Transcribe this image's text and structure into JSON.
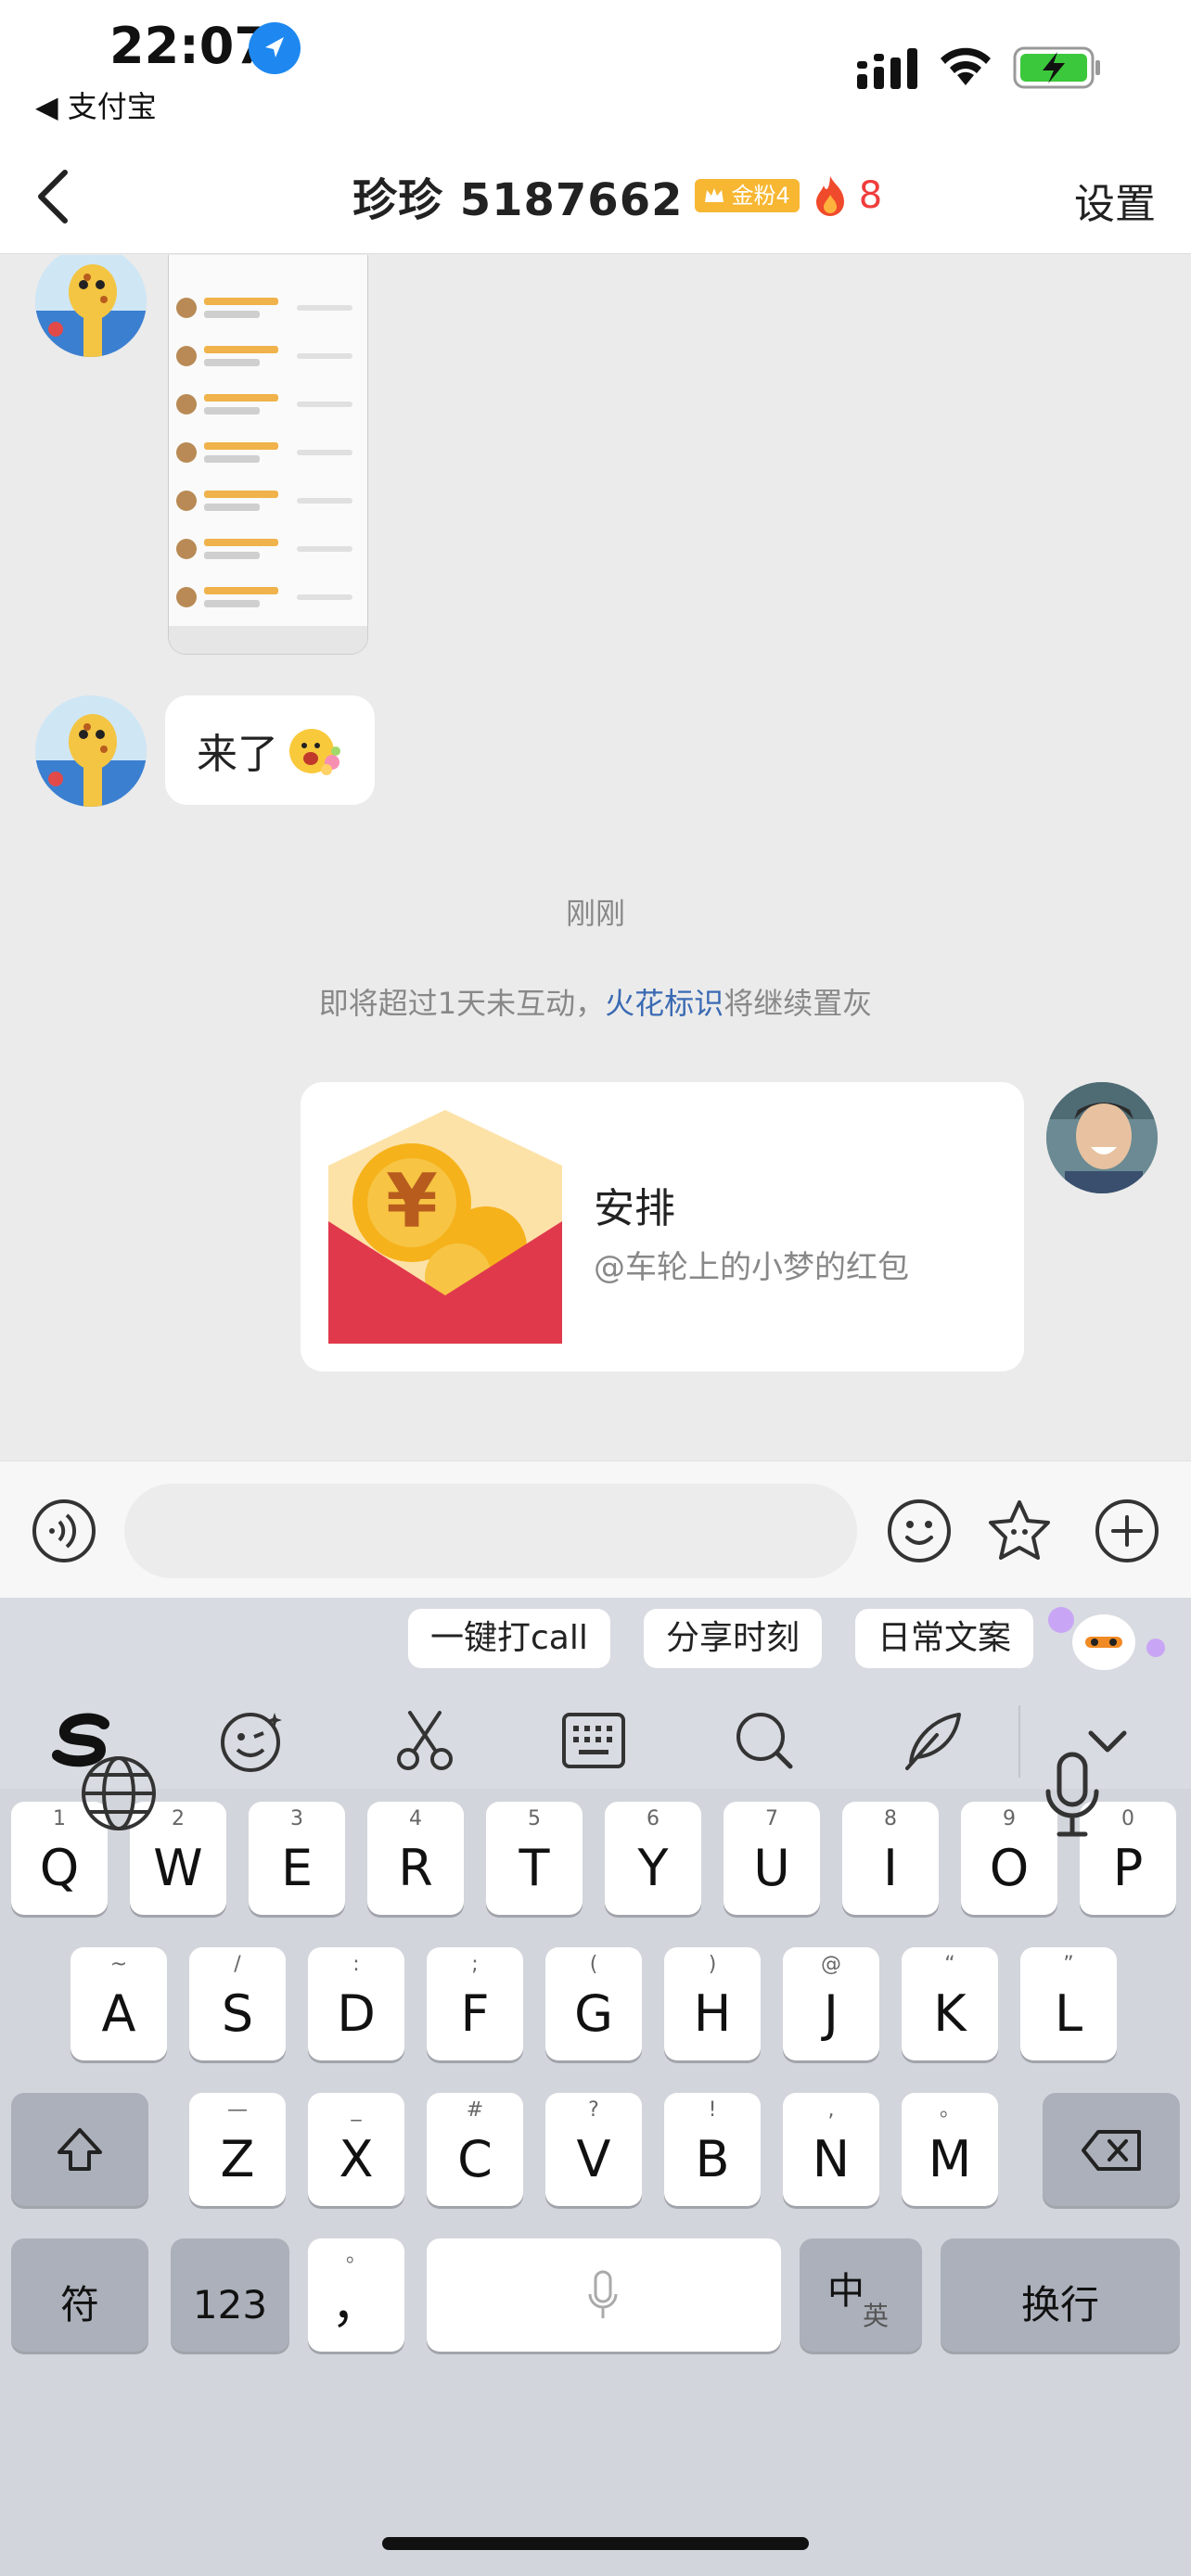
{
  "status_bar": {
    "time": "22:07",
    "back_app": "◀ 支付宝",
    "icons": [
      "location-arrow-icon",
      "cellular-signal-icon",
      "wifi-icon",
      "battery-charging-icon"
    ]
  },
  "nav": {
    "title": "珍珍 5187662",
    "fan_badge": "金粉4",
    "fire_count": "8",
    "settings": "设置"
  },
  "chat": {
    "messages": [
      {
        "side": "left",
        "type": "image"
      },
      {
        "side": "left",
        "type": "text",
        "text": "来了"
      }
    ],
    "time_label": "刚刚",
    "system_tip": {
      "before": "即将超过1天未互动，",
      "link": "火花标识",
      "after": "将继续置灰"
    },
    "red_packet": {
      "title": "安排",
      "subtitle": "@车轮上的小梦的红包"
    }
  },
  "input_bar": {
    "placeholder": ""
  },
  "keyboard": {
    "chips": [
      "一键打call",
      "分享时刻",
      "日常文案"
    ],
    "tools": [
      "sogou-logo-icon",
      "emoji-icon",
      "scissors-icon",
      "keyboard-icon",
      "search-icon",
      "pen-icon",
      "chevron-down-icon"
    ],
    "row1": [
      {
        "main": "Q",
        "sub": "1"
      },
      {
        "main": "W",
        "sub": "2"
      },
      {
        "main": "E",
        "sub": "3"
      },
      {
        "main": "R",
        "sub": "4"
      },
      {
        "main": "T",
        "sub": "5"
      },
      {
        "main": "Y",
        "sub": "6"
      },
      {
        "main": "U",
        "sub": "7"
      },
      {
        "main": "I",
        "sub": "8"
      },
      {
        "main": "O",
        "sub": "9"
      },
      {
        "main": "P",
        "sub": "0"
      }
    ],
    "row2": [
      {
        "main": "A",
        "sub": "~"
      },
      {
        "main": "S",
        "sub": "/"
      },
      {
        "main": "D",
        "sub": ":"
      },
      {
        "main": "F",
        "sub": ";"
      },
      {
        "main": "G",
        "sub": "("
      },
      {
        "main": "H",
        "sub": ")"
      },
      {
        "main": "J",
        "sub": "@"
      },
      {
        "main": "K",
        "sub": "“"
      },
      {
        "main": "L",
        "sub": "”"
      }
    ],
    "row3": [
      {
        "main": "Z",
        "sub": "—"
      },
      {
        "main": "X",
        "sub": "_"
      },
      {
        "main": "C",
        "sub": "#"
      },
      {
        "main": "V",
        "sub": "?"
      },
      {
        "main": "B",
        "sub": "!"
      },
      {
        "main": "N",
        "sub": ","
      },
      {
        "main": "M",
        "sub": "。"
      }
    ],
    "symbol_key": "符",
    "number_key": "123",
    "punct_key": "，",
    "punct_sub": "。",
    "lang_key_main": "中",
    "lang_key_sub": "英",
    "return_key": "换行"
  }
}
